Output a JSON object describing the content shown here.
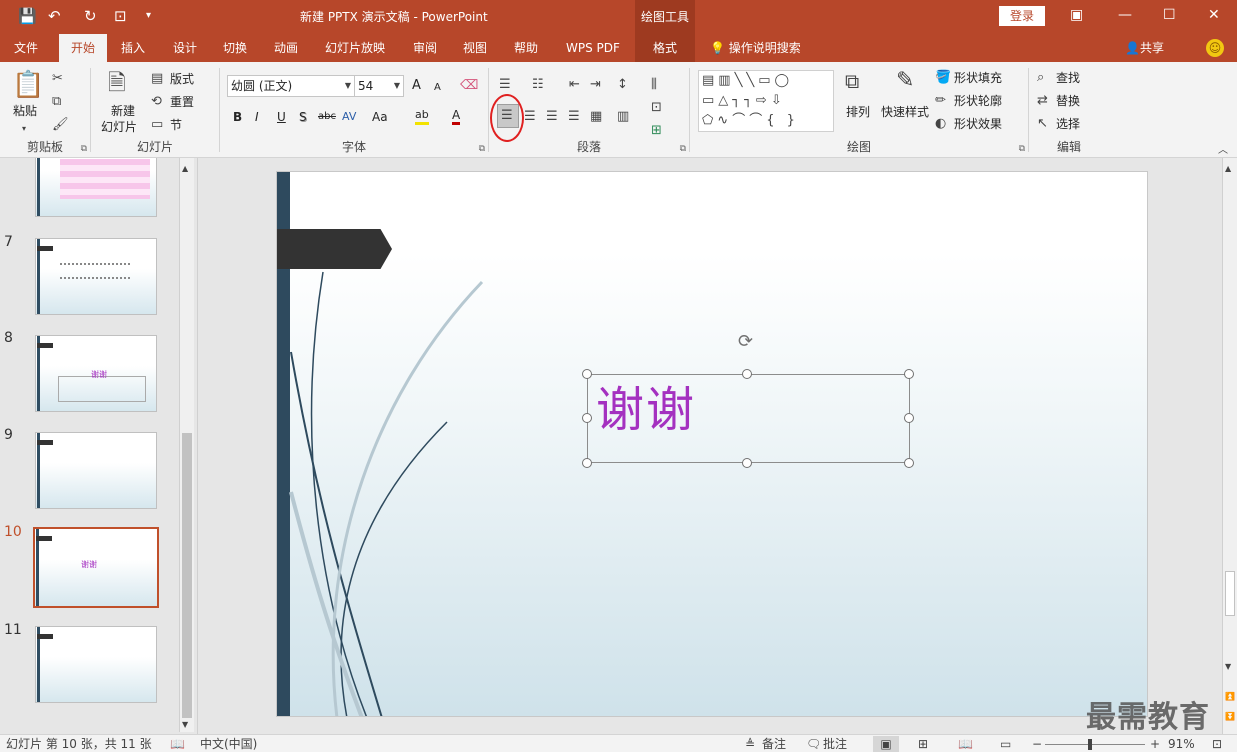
{
  "titlebar": {
    "doc_title": "新建 PPTX 演示文稿  -  PowerPoint",
    "context_group": "绘图工具",
    "login": "登录",
    "qa_save": "💾",
    "qa_undo": "↶",
    "qa_redo": "↻",
    "qa_present": "⊡",
    "qa_more": "▾"
  },
  "tabs": [
    "文件",
    "开始",
    "插入",
    "设计",
    "切换",
    "动画",
    "幻灯片放映",
    "审阅",
    "视图",
    "帮助",
    "WPS PDF",
    "格式"
  ],
  "tellme": "操作说明搜索",
  "share": "共享",
  "ribbon": {
    "clipboard": {
      "label": "剪贴板",
      "paste": "粘贴"
    },
    "slides": {
      "label": "幻灯片",
      "new_slide_line1": "新建",
      "new_slide_line2": "幻灯片",
      "layout": "版式",
      "reset": "重置",
      "section": "节"
    },
    "font": {
      "label": "字体",
      "font_name": "幼圆 (正文)",
      "font_size": "54",
      "bold": "B",
      "italic": "I",
      "underline": "U",
      "shadow": "S",
      "strike": "abc",
      "spacing": "AV",
      "case": "Aa",
      "grow": "A",
      "shrink": "A",
      "highlight": "ab",
      "color": "A"
    },
    "paragraph": {
      "label": "段落"
    },
    "drawing": {
      "label": "绘图",
      "arrange": "排列",
      "quick_styles": "快速样式",
      "fill": "形状填充",
      "outline": "形状轮廓",
      "effects": "形状效果"
    },
    "editing": {
      "label": "编辑",
      "find": "查找",
      "replace": "替换",
      "select": "选择"
    }
  },
  "slides": [
    {
      "num": "",
      "text": ""
    },
    {
      "num": "7",
      "text": ""
    },
    {
      "num": "8",
      "text": "谢谢"
    },
    {
      "num": "9",
      "text": ""
    },
    {
      "num": "10",
      "text": "谢谢"
    },
    {
      "num": "11",
      "text": ""
    }
  ],
  "main_slide": {
    "text": "谢谢"
  },
  "status": {
    "slide_info": "幻灯片 第 10 张，共 11 张",
    "language": "中文(中国)",
    "notes": "备注",
    "comments": "批注",
    "zoom": "91%"
  },
  "watermark": "最需教育",
  "colors": {
    "accent": "#b7472a",
    "text_purple": "#a431c0",
    "slide_bar": "#2e4a5e"
  }
}
